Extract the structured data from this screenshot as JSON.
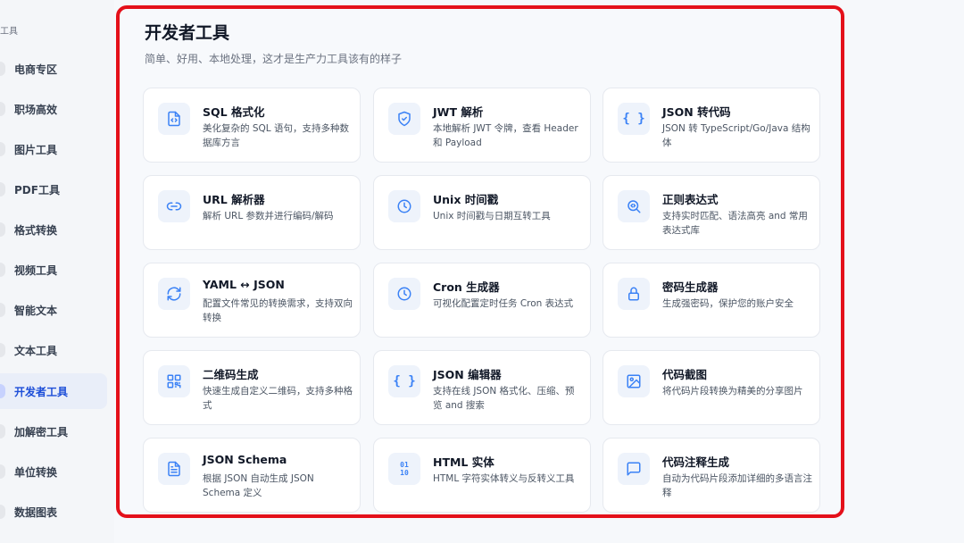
{
  "sidebar": {
    "header": "工具",
    "items": [
      {
        "label": "电商专区"
      },
      {
        "label": "职场高效"
      },
      {
        "label": "图片工具"
      },
      {
        "label": "PDF工具"
      },
      {
        "label": "格式转换"
      },
      {
        "label": "视频工具"
      },
      {
        "label": "智能文本"
      },
      {
        "label": "文本工具"
      },
      {
        "label": "开发者工具",
        "active": true
      },
      {
        "label": "加解密工具"
      },
      {
        "label": "单位转换"
      },
      {
        "label": "数据图表"
      }
    ]
  },
  "main": {
    "title": "开发者工具",
    "subtitle": "简单、好用、本地处理，这才是生产力工具该有的样子",
    "accent_color": "#3b82f6",
    "highlight_border_color": "#e4101a",
    "tools": [
      {
        "title": "SQL 格式化",
        "desc": "美化复杂的 SQL 语句，支持多种数据库方言",
        "icon": "file-code-icon"
      },
      {
        "title": "JWT 解析",
        "desc": "本地解析 JWT 令牌，查看 Header 和 Payload",
        "icon": "shield-icon"
      },
      {
        "title": "JSON 转代码",
        "desc": "JSON 转 TypeScript/Go/Java 结构体",
        "icon": "braces-icon"
      },
      {
        "title": "URL 解析器",
        "desc": "解析 URL 参数并进行编码/解码",
        "icon": "link-icon"
      },
      {
        "title": "Unix 时间戳",
        "desc": "Unix 时间戳与日期互转工具",
        "icon": "clock-icon"
      },
      {
        "title": "正则表达式",
        "desc": "支持实时匹配、语法高亮 and 常用表达式库",
        "icon": "search-code-icon"
      },
      {
        "title": "YAML ↔ JSON",
        "desc": "配置文件常见的转换需求，支持双向转换",
        "icon": "refresh-icon"
      },
      {
        "title": "Cron 生成器",
        "desc": "可视化配置定时任务 Cron 表达式",
        "icon": "clock-icon"
      },
      {
        "title": "密码生成器",
        "desc": "生成强密码，保护您的账户安全",
        "icon": "lock-icon"
      },
      {
        "title": "二维码生成",
        "desc": "快速生成自定义二维码，支持多种格式",
        "icon": "qr-code-icon"
      },
      {
        "title": "JSON 编辑器",
        "desc": "支持在线 JSON 格式化、压缩、预览 and 搜索",
        "icon": "braces-icon"
      },
      {
        "title": "代码截图",
        "desc": "将代码片段转换为精美的分享图片",
        "icon": "image-icon"
      },
      {
        "title": "JSON Schema",
        "desc": "根据 JSON 自动生成 JSON Schema 定义",
        "icon": "file-text-icon"
      },
      {
        "title": "HTML 实体",
        "desc": "HTML 字符实体转义与反转义工具",
        "icon": "binary-icon"
      },
      {
        "title": "代码注释生成",
        "desc": "自动为代码片段添加详细的多语言注释",
        "icon": "message-icon"
      }
    ]
  }
}
